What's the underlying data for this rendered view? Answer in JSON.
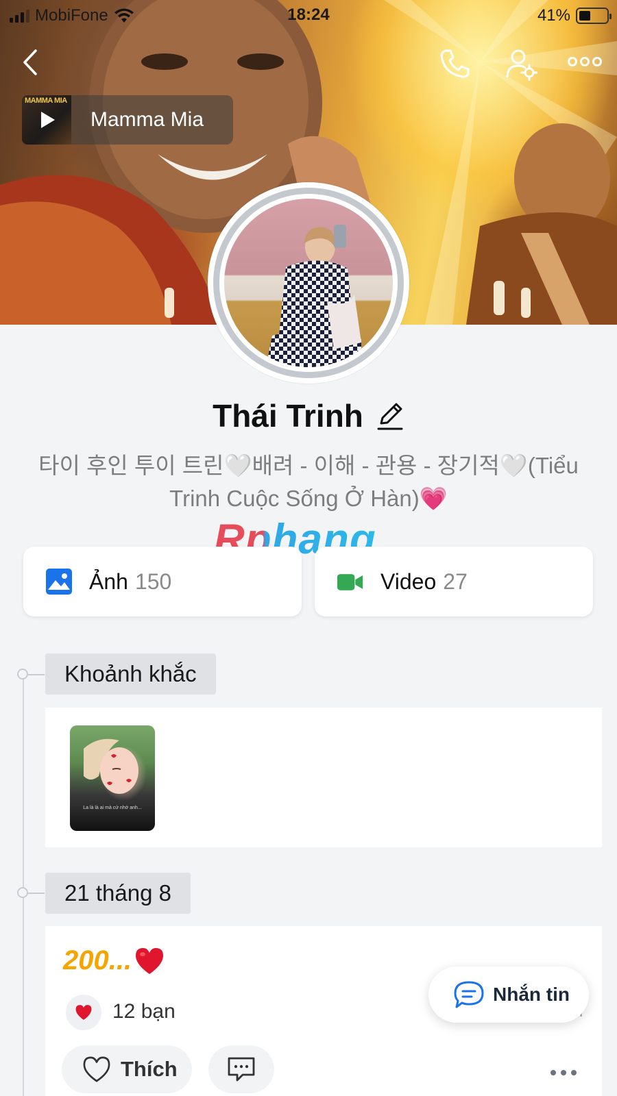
{
  "status_bar": {
    "carrier": "MobiFone",
    "time": "18:24",
    "battery_text": "41%",
    "battery_level": 0.41
  },
  "nav": {
    "icons": [
      "back-icon",
      "phone-icon",
      "user-settings-icon",
      "more-icon"
    ]
  },
  "music": {
    "album_text": "MAMMA MIA",
    "title": "Mamma Mia"
  },
  "profile": {
    "name": "Thái Trinh",
    "bio": "타이 후인 투이 트린🤍배려 - 이해 - 관용 - 장기적🤍(Tiểu Trinh Cuộc Sống Ở Hàn)💗"
  },
  "watermark": "Rphang",
  "media": {
    "photos": {
      "label": "Ảnh",
      "count": "150",
      "icon": "image-icon",
      "color": "#1a73e8"
    },
    "videos": {
      "label": "Video",
      "count": "27",
      "icon": "video-camera-icon",
      "color": "#34a853"
    }
  },
  "timeline": {
    "moments_label": "Khoảnh khắc",
    "moment_caption": "La là là ai mà cứ nhớ anh...",
    "date_label": "21 tháng 8"
  },
  "post": {
    "title": "200...",
    "reaction_count": "12 bạn",
    "like_label": "Thích",
    "meta_text": "l"
  },
  "message_button": {
    "label": "Nhắn tin"
  },
  "colors": {
    "accent_blue": "#1a73e8",
    "accent_green": "#34a853",
    "post_title": "#f4a500",
    "heart_red": "#e0152e",
    "background": "#f3f4f6"
  }
}
